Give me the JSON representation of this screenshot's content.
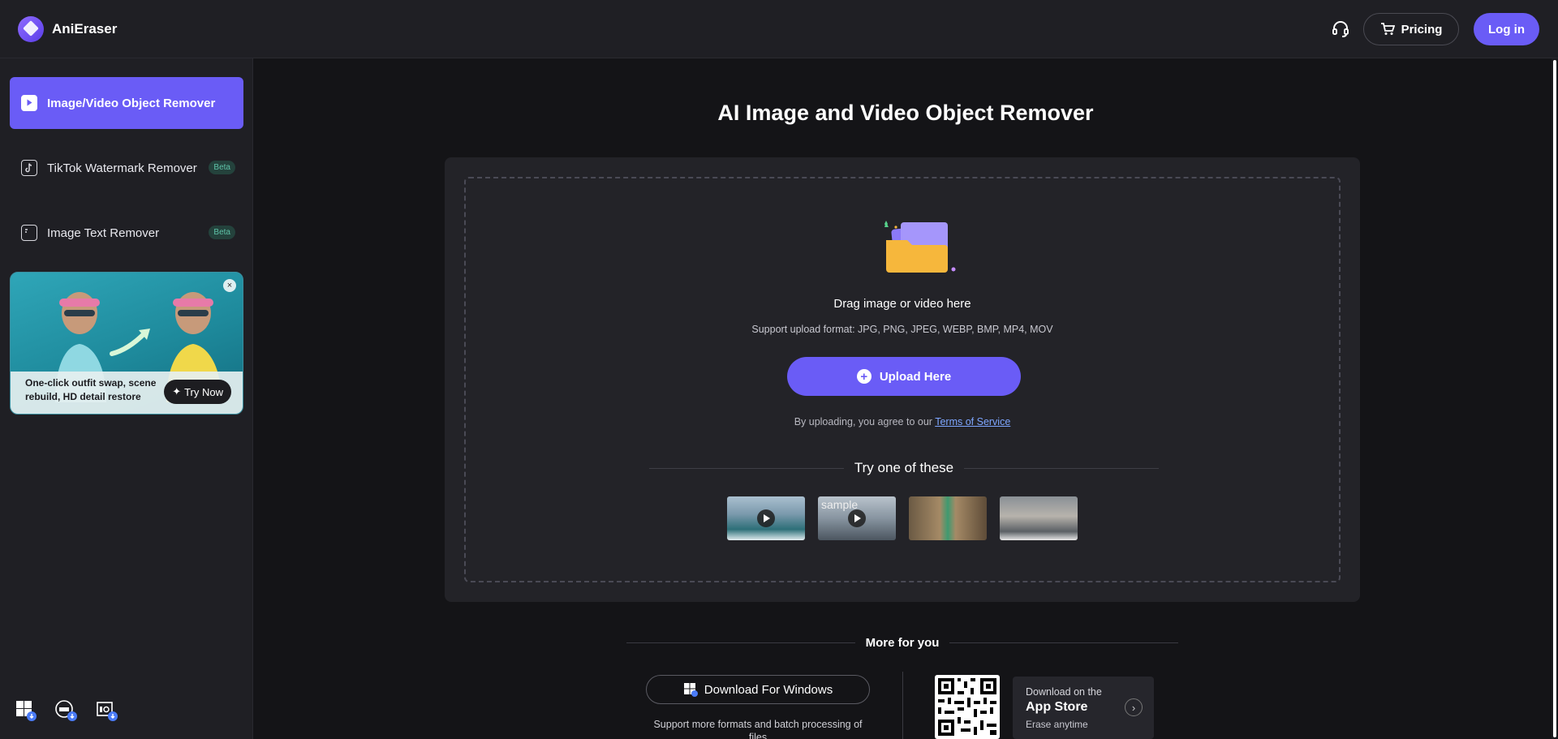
{
  "app": {
    "name": "AniEraser"
  },
  "header": {
    "pricing_label": "Pricing",
    "login_label": "Log in"
  },
  "sidebar": {
    "items": [
      {
        "label": "Image/Video Object Remover",
        "badge": ""
      },
      {
        "label": "TikTok Watermark Remover",
        "badge": "Beta"
      },
      {
        "label": "Image Text Remover",
        "badge": "Beta"
      }
    ],
    "promo": {
      "text": "One-click outfit swap, scene rebuild, HD detail restore",
      "cta": "Try Now",
      "close": "×"
    }
  },
  "main": {
    "title": "AI Image and Video Object Remover",
    "drag_text": "Drag image or video here",
    "formats": "Support upload format: JPG, PNG, JPEG, WEBP, BMP, MP4, MOV",
    "upload_label": "Upload Here",
    "agree_prefix": "By uploading, you agree to our ",
    "terms_label": "Terms of Service",
    "try_label": "Try one of these",
    "sample_alt": "sample"
  },
  "more": {
    "title": "More for you",
    "windows_label": "Download For Windows",
    "windows_sub": "Support more formats and batch processing of files",
    "appstore_small": "Download on the",
    "appstore_big": "App Store",
    "appstore_sub": "Erase anytime"
  },
  "colors": {
    "accent": "#6a5cf6",
    "beta_text": "#5fc3a8",
    "link": "#7ea6ff"
  }
}
